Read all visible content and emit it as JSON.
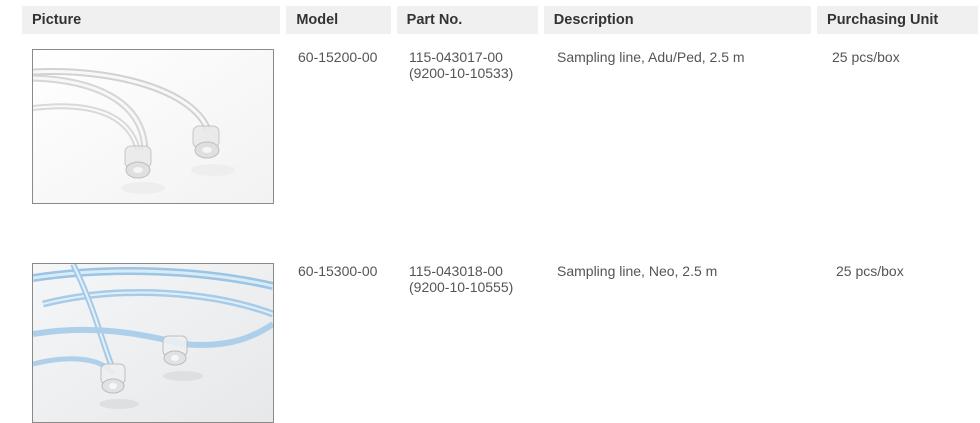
{
  "columns": {
    "picture": "Picture",
    "model": "Model",
    "part_no": "Part No.",
    "description": "Description",
    "purchasing_unit": "Purchasing Unit"
  },
  "rows": [
    {
      "picture_icon": "clear-sampling-line-photo",
      "model": "60-15200-00",
      "part_no_line1": "115-043017-00",
      "part_no_line2": "(9200-10-10533)",
      "description": "Sampling line, Adu/Ped, 2.5 m",
      "purchasing_unit": "25 pcs/box"
    },
    {
      "picture_icon": "blue-sampling-line-photo",
      "model": "60-15300-00",
      "part_no_line1": "115-043018-00",
      "part_no_line2": "(9200-10-10555)",
      "description": "Sampling line, Neo, 2.5 m",
      "purchasing_unit": "25 pcs/box"
    }
  ],
  "colors": {
    "header_bg": "#f0f0f0",
    "header_text": "#333333",
    "body_text": "#555555",
    "photo_border": "#8a8a8a",
    "tube_blue": "#9cc4e4"
  }
}
